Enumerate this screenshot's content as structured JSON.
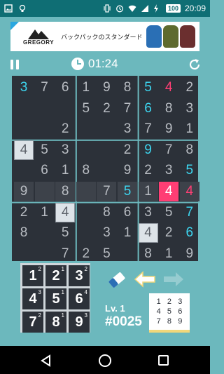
{
  "status_bar": {
    "time": "20:09",
    "battery": "100",
    "icons": [
      "image-icon",
      "lightbulb-icon",
      "vibrate-icon",
      "alarm-icon",
      "wifi-icon",
      "signal-icon",
      "battery-icon"
    ]
  },
  "ad": {
    "brand": "GREGORY",
    "text": "バックパックのスタンダード",
    "bag_colors": [
      "#2a6fb5",
      "#5e6a2e",
      "#6b2f2f"
    ]
  },
  "game": {
    "timer": "01:24",
    "level_label": "Lv. 1",
    "puzzle_number": "#0025"
  },
  "colors": {
    "background": "#6cb8bd",
    "board": "#2c3139",
    "given": "#b9bdc3",
    "entered": "#ffffff",
    "cyan": "#3dd6f0",
    "pink": "#ff3e74"
  },
  "grid": [
    [
      [
        "3",
        "c"
      ],
      [
        "7",
        "g"
      ],
      [
        "6",
        "g"
      ],
      [
        "1",
        "g"
      ],
      [
        "9",
        "g"
      ],
      [
        "8",
        "g"
      ],
      [
        "5",
        "c"
      ],
      [
        "4",
        "p"
      ],
      [
        "2",
        "g"
      ]
    ],
    [
      [
        "",
        "g"
      ],
      [
        "",
        "g"
      ],
      [
        "",
        "g"
      ],
      [
        "5",
        "g"
      ],
      [
        "2",
        "g"
      ],
      [
        "7",
        "g"
      ],
      [
        "6",
        "c"
      ],
      [
        "8",
        "g"
      ],
      [
        "3",
        "g"
      ]
    ],
    [
      [
        "",
        "g"
      ],
      [
        "",
        "g"
      ],
      [
        "2",
        "g"
      ],
      [
        "",
        "g"
      ],
      [
        "",
        "g"
      ],
      [
        "3",
        "g"
      ],
      [
        "7",
        "g"
      ],
      [
        "9",
        "g"
      ],
      [
        "1",
        "g"
      ]
    ],
    [
      [
        "4",
        "s"
      ],
      [
        "5",
        "g"
      ],
      [
        "3",
        "g"
      ],
      [
        "",
        "g"
      ],
      [
        "",
        "g"
      ],
      [
        "2",
        "g"
      ],
      [
        "9",
        "c"
      ],
      [
        "7",
        "g"
      ],
      [
        "8",
        "g"
      ]
    ],
    [
      [
        "",
        "g"
      ],
      [
        "6",
        "g"
      ],
      [
        "1",
        "g"
      ],
      [
        "8",
        "g"
      ],
      [
        "",
        "g"
      ],
      [
        "9",
        "g"
      ],
      [
        "2",
        "g"
      ],
      [
        "3",
        "g"
      ],
      [
        "5",
        "c"
      ]
    ],
    [
      [
        "9",
        "h"
      ],
      [
        "",
        "h"
      ],
      [
        "8",
        "h"
      ],
      [
        "",
        "h"
      ],
      [
        "7",
        "h"
      ],
      [
        "5",
        "hc"
      ],
      [
        "1",
        "h"
      ],
      [
        "4",
        "e"
      ],
      [
        "4",
        "hp"
      ]
    ],
    [
      [
        "2",
        "g"
      ],
      [
        "1",
        "g"
      ],
      [
        "4",
        "s"
      ],
      [
        "",
        "g"
      ],
      [
        "8",
        "g"
      ],
      [
        "6",
        "g"
      ],
      [
        "3",
        "g"
      ],
      [
        "5",
        "g"
      ],
      [
        "7",
        "c"
      ]
    ],
    [
      [
        "8",
        "g"
      ],
      [
        "",
        "g"
      ],
      [
        "5",
        "g"
      ],
      [
        "",
        "g"
      ],
      [
        "3",
        "g"
      ],
      [
        "1",
        "g"
      ],
      [
        "4",
        "s"
      ],
      [
        "2",
        "g"
      ],
      [
        "6",
        "c"
      ]
    ],
    [
      [
        "",
        "g"
      ],
      [
        "",
        "g"
      ],
      [
        "7",
        "g"
      ],
      [
        "2",
        "g"
      ],
      [
        "5",
        "g"
      ],
      [
        "",
        "g"
      ],
      [
        "8",
        "g"
      ],
      [
        "1",
        "g"
      ],
      [
        "9",
        "g"
      ]
    ]
  ],
  "keypad": [
    {
      "digit": "1",
      "count": "2"
    },
    {
      "digit": "2",
      "count": "1"
    },
    {
      "digit": "3",
      "count": "2"
    },
    {
      "digit": "4",
      "count": "3"
    },
    {
      "digit": "5",
      "count": "1"
    },
    {
      "digit": "6",
      "count": "4"
    },
    {
      "digit": "7",
      "count": "2"
    },
    {
      "digit": "8",
      "count": "1"
    },
    {
      "digit": "9",
      "count": "3"
    }
  ],
  "memo_digits": [
    "1",
    "2",
    "3",
    "4",
    "5",
    "6",
    "7",
    "8",
    "9"
  ]
}
